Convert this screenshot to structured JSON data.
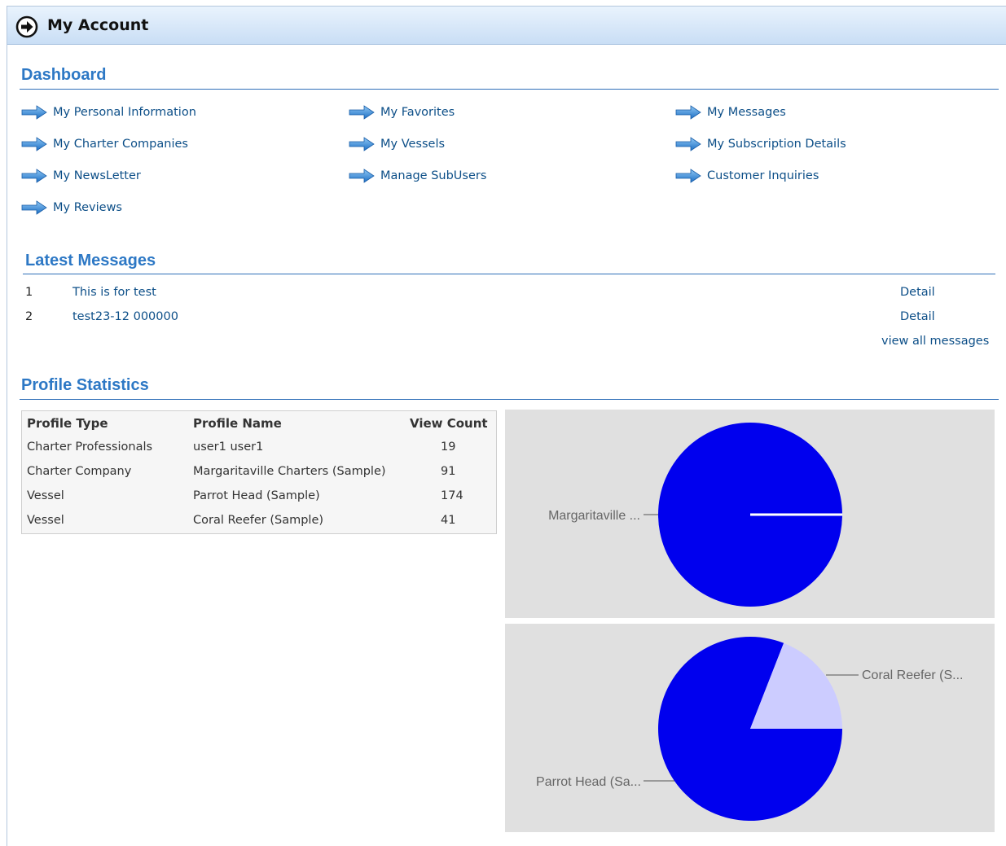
{
  "header": {
    "title": "My Account",
    "icon": "circle-arrow-right-icon"
  },
  "dashboard": {
    "title": "Dashboard",
    "links": [
      "My Personal Information",
      "My Favorites",
      "My Messages",
      "My Charter Companies",
      "My Vessels",
      "My Subscription Details",
      "My NewsLetter",
      "Manage SubUsers",
      "Customer Inquiries",
      "My Reviews"
    ]
  },
  "latest_messages": {
    "title": "Latest Messages",
    "items": [
      {
        "num": "1",
        "subject": "This is for test",
        "detail": "Detail"
      },
      {
        "num": "2",
        "subject": "test23-12 000000",
        "detail": "Detail"
      }
    ],
    "view_all": "view all messages"
  },
  "profile_statistics": {
    "title": "Profile Statistics",
    "columns": [
      "Profile Type",
      "Profile Name",
      "View Count"
    ],
    "rows": [
      [
        "Charter Professionals",
        "user1 user1",
        "19"
      ],
      [
        "Charter Company",
        "Margaritaville Charters (Sample)",
        "91"
      ],
      [
        "Vessel",
        "Parrot Head (Sample)",
        "174"
      ],
      [
        "Vessel",
        "Coral Reefer (Sample)",
        "41"
      ]
    ]
  },
  "colors": {
    "accent": "#2d78c5",
    "link": "#0d4f88",
    "pie_primary": "#0000ee",
    "pie_secondary": "#ccccff",
    "panel": "#e0e0e0"
  },
  "chart_data": [
    {
      "type": "pie",
      "slices": [
        {
          "label": "Margaritaville ...",
          "value": 91
        }
      ]
    },
    {
      "type": "pie",
      "slices": [
        {
          "label": "Parrot Head (Sa...",
          "value": 174
        },
        {
          "label": "Coral Reefer (S...",
          "value": 41
        }
      ]
    }
  ]
}
